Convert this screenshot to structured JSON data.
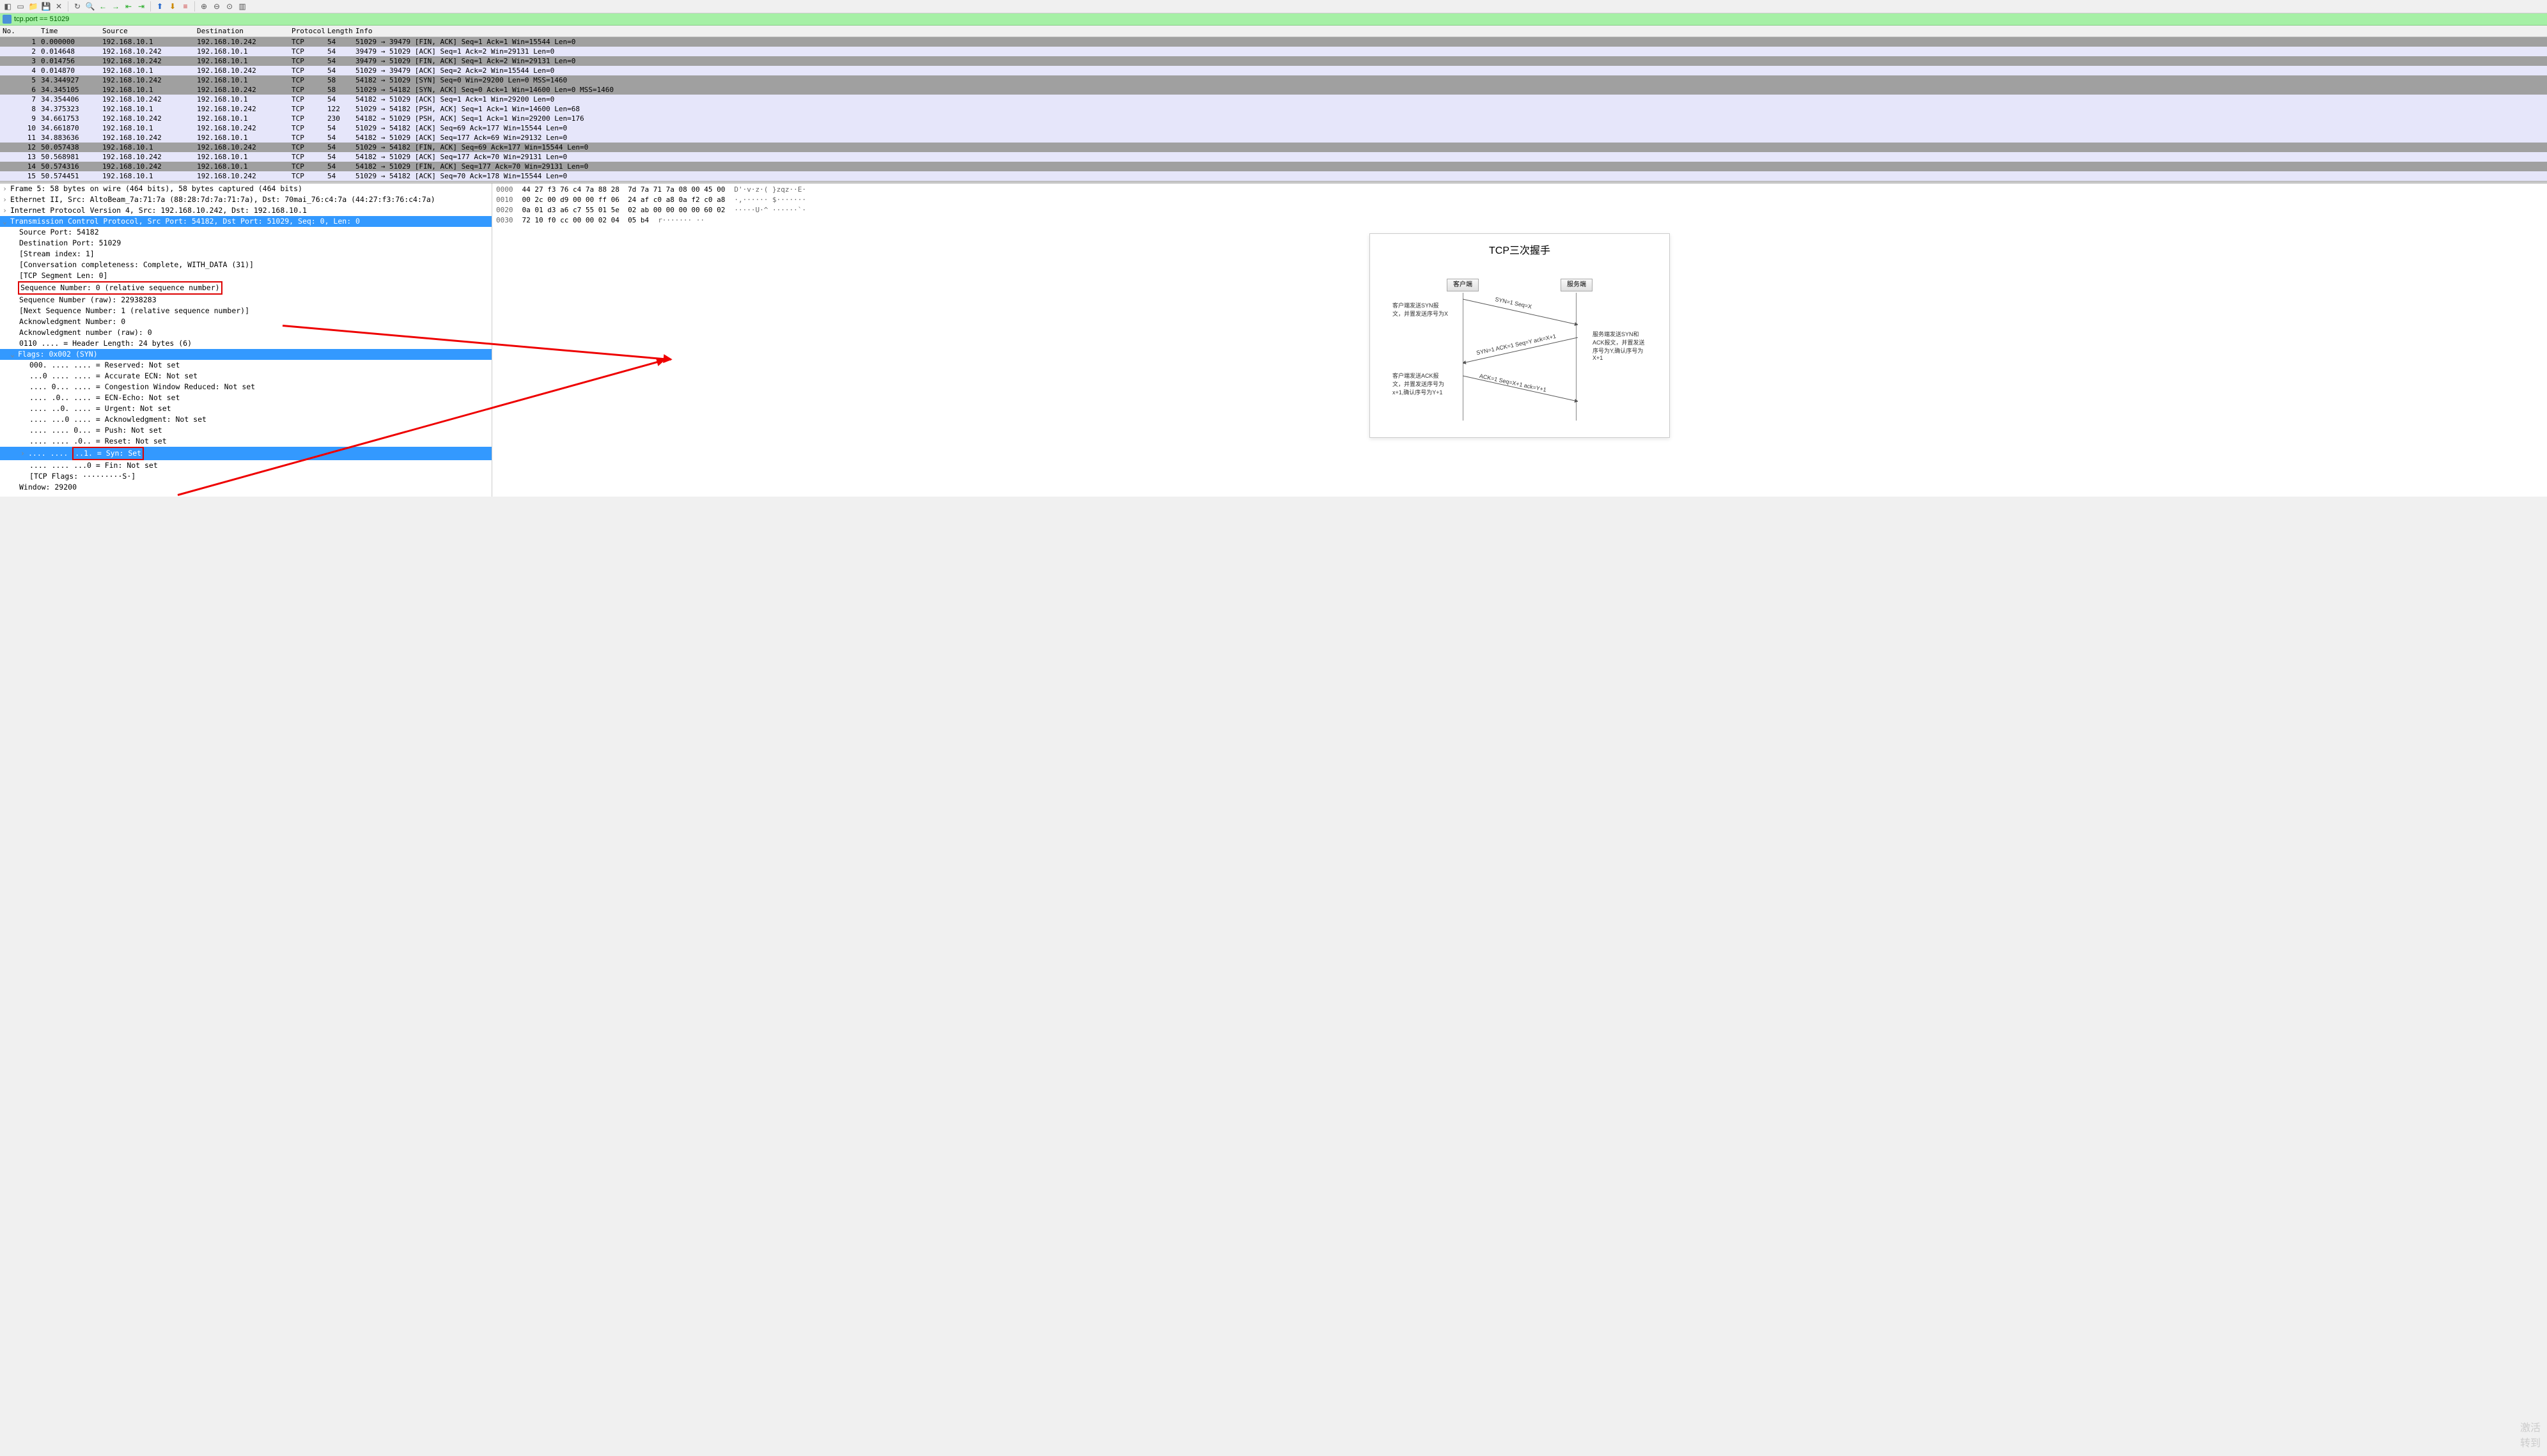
{
  "toolbar_icons": [
    "file",
    "blank",
    "folder",
    "save",
    "close",
    "reload",
    "search",
    "left",
    "right",
    "skip-start",
    "skip-end",
    "up",
    "down",
    "list",
    "zoom-in",
    "zoom-out",
    "zoom-fit",
    "columns"
  ],
  "filter_text": "tcp.port == 51029",
  "columns": {
    "no": "No.",
    "time": "Time",
    "source": "Source",
    "dest": "Destination",
    "proto": "Protocol",
    "len": "Length",
    "info": "Info"
  },
  "packets": [
    {
      "no": "1",
      "time": "0.000000",
      "src": "192.168.10.1",
      "dst": "192.168.10.242",
      "proto": "TCP",
      "len": "54",
      "info": "51029 → 39479 [FIN, ACK] Seq=1 Ack=1 Win=15544 Len=0",
      "cls": "a0a0a0"
    },
    {
      "no": "2",
      "time": "0.014648",
      "src": "192.168.10.242",
      "dst": "192.168.10.1",
      "proto": "TCP",
      "len": "54",
      "info": "39479 → 51029 [ACK] Seq=1 Ack=2 Win=29131 Len=0",
      "cls": "e6e6fa"
    },
    {
      "no": "3",
      "time": "0.014756",
      "src": "192.168.10.242",
      "dst": "192.168.10.1",
      "proto": "TCP",
      "len": "54",
      "info": "39479 → 51029 [FIN, ACK] Seq=1 Ack=2 Win=29131 Len=0",
      "cls": "a0a0a0"
    },
    {
      "no": "4",
      "time": "0.014870",
      "src": "192.168.10.1",
      "dst": "192.168.10.242",
      "proto": "TCP",
      "len": "54",
      "info": "51029 → 39479 [ACK] Seq=2 Ack=2 Win=15544 Len=0",
      "cls": "e6e6fa"
    },
    {
      "no": "5",
      "time": "34.344927",
      "src": "192.168.10.242",
      "dst": "192.168.10.1",
      "proto": "TCP",
      "len": "58",
      "info": "54182 → 51029 [SYN] Seq=0 Win=29200 Len=0 MSS=1460",
      "cls": "a0a0a0"
    },
    {
      "no": "6",
      "time": "34.345105",
      "src": "192.168.10.1",
      "dst": "192.168.10.242",
      "proto": "TCP",
      "len": "58",
      "info": "51029 → 54182 [SYN, ACK] Seq=0 Ack=1 Win=14600 Len=0 MSS=1460",
      "cls": "a0a0a0"
    },
    {
      "no": "7",
      "time": "34.354406",
      "src": "192.168.10.242",
      "dst": "192.168.10.1",
      "proto": "TCP",
      "len": "54",
      "info": "54182 → 51029 [ACK] Seq=1 Ack=1 Win=29200 Len=0",
      "cls": "e6e6fa"
    },
    {
      "no": "8",
      "time": "34.375323",
      "src": "192.168.10.1",
      "dst": "192.168.10.242",
      "proto": "TCP",
      "len": "122",
      "info": "51029 → 54182 [PSH, ACK] Seq=1 Ack=1 Win=14600 Len=68",
      "cls": "e6e6fa"
    },
    {
      "no": "9",
      "time": "34.661753",
      "src": "192.168.10.242",
      "dst": "192.168.10.1",
      "proto": "TCP",
      "len": "230",
      "info": "54182 → 51029 [PSH, ACK] Seq=1 Ack=1 Win=29200 Len=176",
      "cls": "e6e6fa"
    },
    {
      "no": "10",
      "time": "34.661870",
      "src": "192.168.10.1",
      "dst": "192.168.10.242",
      "proto": "TCP",
      "len": "54",
      "info": "51029 → 54182 [ACK] Seq=69 Ack=177 Win=15544 Len=0",
      "cls": "e6e6fa"
    },
    {
      "no": "11",
      "time": "34.883636",
      "src": "192.168.10.242",
      "dst": "192.168.10.1",
      "proto": "TCP",
      "len": "54",
      "info": "54182 → 51029 [ACK] Seq=177 Ack=69 Win=29132 Len=0",
      "cls": "e6e6fa"
    },
    {
      "no": "12",
      "time": "50.057438",
      "src": "192.168.10.1",
      "dst": "192.168.10.242",
      "proto": "TCP",
      "len": "54",
      "info": "51029 → 54182 [FIN, ACK] Seq=69 Ack=177 Win=15544 Len=0",
      "cls": "a0a0a0"
    },
    {
      "no": "13",
      "time": "50.568981",
      "src": "192.168.10.242",
      "dst": "192.168.10.1",
      "proto": "TCP",
      "len": "54",
      "info": "54182 → 51029 [ACK] Seq=177 Ack=70 Win=29131 Len=0",
      "cls": "e6e6fa"
    },
    {
      "no": "14",
      "time": "50.574316",
      "src": "192.168.10.242",
      "dst": "192.168.10.1",
      "proto": "TCP",
      "len": "54",
      "info": "54182 → 51029 [FIN, ACK] Seq=177 Ack=70 Win=29131 Len=0",
      "cls": "a0a0a0"
    },
    {
      "no": "15",
      "time": "50.574451",
      "src": "192.168.10.1",
      "dst": "192.168.10.242",
      "proto": "TCP",
      "len": "54",
      "info": "51029 → 54182 [ACK] Seq=70 Ack=178 Win=15544 Len=0",
      "cls": "e6e6fa"
    }
  ],
  "details": {
    "frame": "Frame 5: 58 bytes on wire (464 bits), 58 bytes captured (464 bits)",
    "eth": "Ethernet II, Src: AltoBeam_7a:71:7a (88:28:7d:7a:71:7a), Dst: 70mai_76:c4:7a (44:27:f3:76:c4:7a)",
    "ip": "Internet Protocol Version 4, Src: 192.168.10.242, Dst: 192.168.10.1",
    "tcp": "Transmission Control Protocol, Src Port: 54182, Dst Port: 51029, Seq: 0, Len: 0",
    "srcport": "Source Port: 54182",
    "dstport": "Destination Port: 51029",
    "stream": "[Stream index: 1]",
    "conv": "[Conversation completeness: Complete, WITH_DATA (31)]",
    "seglen": "[TCP Segment Len: 0]",
    "seqnum": "Sequence Number: 0    (relative sequence number)",
    "seqraw": "Sequence Number (raw): 22938283",
    "nextseq": "[Next Sequence Number: 1    (relative sequence number)]",
    "acknum": "Acknowledgment Number: 0",
    "ackraw": "Acknowledgment number (raw): 0",
    "hdrlen": "0110 .... = Header Length: 24 bytes (6)",
    "flags": "Flags: 0x002 (SYN)",
    "f_res": "000. .... .... = Reserved: Not set",
    "f_aecn": "...0 .... .... = Accurate ECN: Not set",
    "f_cwr": ".... 0... .... = Congestion Window Reduced: Not set",
    "f_ece": ".... .0.. .... = ECN-Echo: Not set",
    "f_urg": ".... ..0. .... = Urgent: Not set",
    "f_ack": ".... ...0 .... = Acknowledgment: Not set",
    "f_psh": ".... .... 0... = Push: Not set",
    "f_rst": ".... .... .0.. = Reset: Not set",
    "f_syn_pre": ".... .... ",
    "f_syn_box": "..1. = Syn: Set",
    "f_fin": ".... .... ...0 = Fin: Not set",
    "tcpflags": "[TCP Flags: ·········S·]",
    "window": "Window: 29200"
  },
  "hex": [
    {
      "off": "0000",
      "b": "44 27 f3 76 c4 7a 88 28  7d 7a 71 7a 08 00 45 00",
      "a": "D'·v·z·( }zqz··E·"
    },
    {
      "off": "0010",
      "b": "00 2c 00 d9 00 00 ff 06  24 af c0 a8 0a f2 c0 a8",
      "a": "·,······ $·······"
    },
    {
      "off": "0020",
      "b": "0a 01 d3 a6 c7 55 01 5e  02 ab 00 00 00 00 60 02",
      "a": "·····U·^ ······`·"
    },
    {
      "off": "0030",
      "b": "72 10 f0 cc 00 00 02 04  05 b4",
      "a": "r······· ··"
    }
  ],
  "diagram": {
    "title": "TCP三次握手",
    "client": "客户端",
    "server": "服务端",
    "note1": "客户端发送SYN报文，并置发送序号为X",
    "arrow1": "SYN=1 Seq=X",
    "note2": "服务端发送SYN和ACK报文，并置发送序号为Y,确认序号为X+1",
    "arrow2": "SYN=1 ACK=1 Seq=Y ack=X+1",
    "note3": "客户端发送ACK报文，并置发送序号为x+1,确认序号为Y+1",
    "arrow3": "ACK=1 Seq=X+1 ack=Y+1"
  },
  "watermark": {
    "l1": "激活",
    "l2": "转到"
  }
}
